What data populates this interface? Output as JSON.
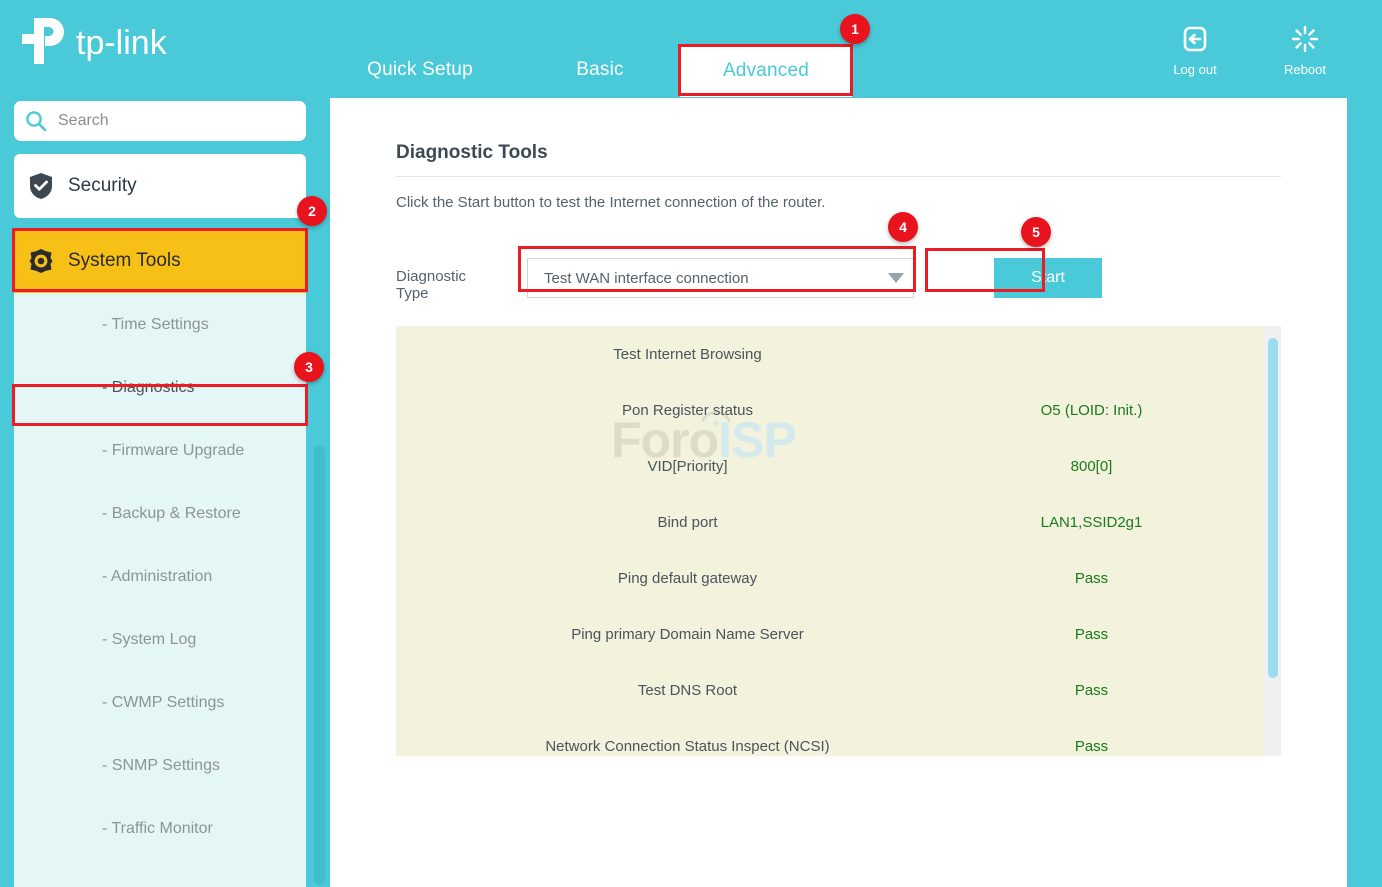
{
  "brand": {
    "name": "tp-link"
  },
  "topnav": {
    "items": [
      {
        "label": "Quick Setup",
        "active": false
      },
      {
        "label": "Basic",
        "active": false
      },
      {
        "label": "Advanced",
        "active": true
      }
    ]
  },
  "topright": {
    "logout": {
      "label": "Log out",
      "icon": "logout-icon"
    },
    "reboot": {
      "label": "Reboot",
      "icon": "reboot-icon"
    }
  },
  "sidebar": {
    "search": {
      "placeholder": "Search",
      "value": "",
      "icon": "search-icon"
    },
    "security": {
      "label": "Security",
      "icon": "shield-check-icon"
    },
    "system_tools": {
      "label": "System Tools",
      "icon": "gear-icon"
    },
    "submenu": [
      {
        "label": "- Time Settings",
        "active": false
      },
      {
        "label": "- Diagnostics",
        "active": true
      },
      {
        "label": "- Firmware Upgrade",
        "active": false
      },
      {
        "label": "- Backup & Restore",
        "active": false
      },
      {
        "label": "- Administration",
        "active": false
      },
      {
        "label": "- System Log",
        "active": false
      },
      {
        "label": "- CWMP Settings",
        "active": false
      },
      {
        "label": "- SNMP Settings",
        "active": false
      },
      {
        "label": "- Traffic Monitor",
        "active": false
      }
    ]
  },
  "main": {
    "title": "Diagnostic Tools",
    "description": "Click the Start button to test the Internet connection of the router.",
    "diagnostic_type_label": "Diagnostic Type",
    "diagnostic_type_value": "Test WAN interface connection",
    "start_label": "Start",
    "results": [
      {
        "name": "Test Internet Browsing",
        "value": ""
      },
      {
        "name": "Pon Register status",
        "value": "O5 (LOID: Init.)"
      },
      {
        "name": "VID[Priority]",
        "value": "800[0]"
      },
      {
        "name": "Bind port",
        "value": "LAN1,SSID2g1"
      },
      {
        "name": "Ping default gateway",
        "value": "Pass"
      },
      {
        "name": "Ping primary Domain Name Server",
        "value": "Pass"
      },
      {
        "name": "Test DNS Root",
        "value": "Pass"
      },
      {
        "name": "Network Connection Status Inspect (NCSI)",
        "value": "Pass"
      }
    ]
  },
  "watermark": {
    "part1": "Foro",
    "part2": "ISP"
  },
  "annotations": [
    {
      "number": "1"
    },
    {
      "number": "2"
    },
    {
      "number": "3"
    },
    {
      "number": "4"
    },
    {
      "number": "5"
    }
  ],
  "colors": {
    "brand_teal": "#4ac9d8",
    "highlight_amber": "#F6C016",
    "annotation_red": "#ec1c24",
    "result_pass_green": "#1a7a1f",
    "results_bg": "#f3f2dc"
  }
}
